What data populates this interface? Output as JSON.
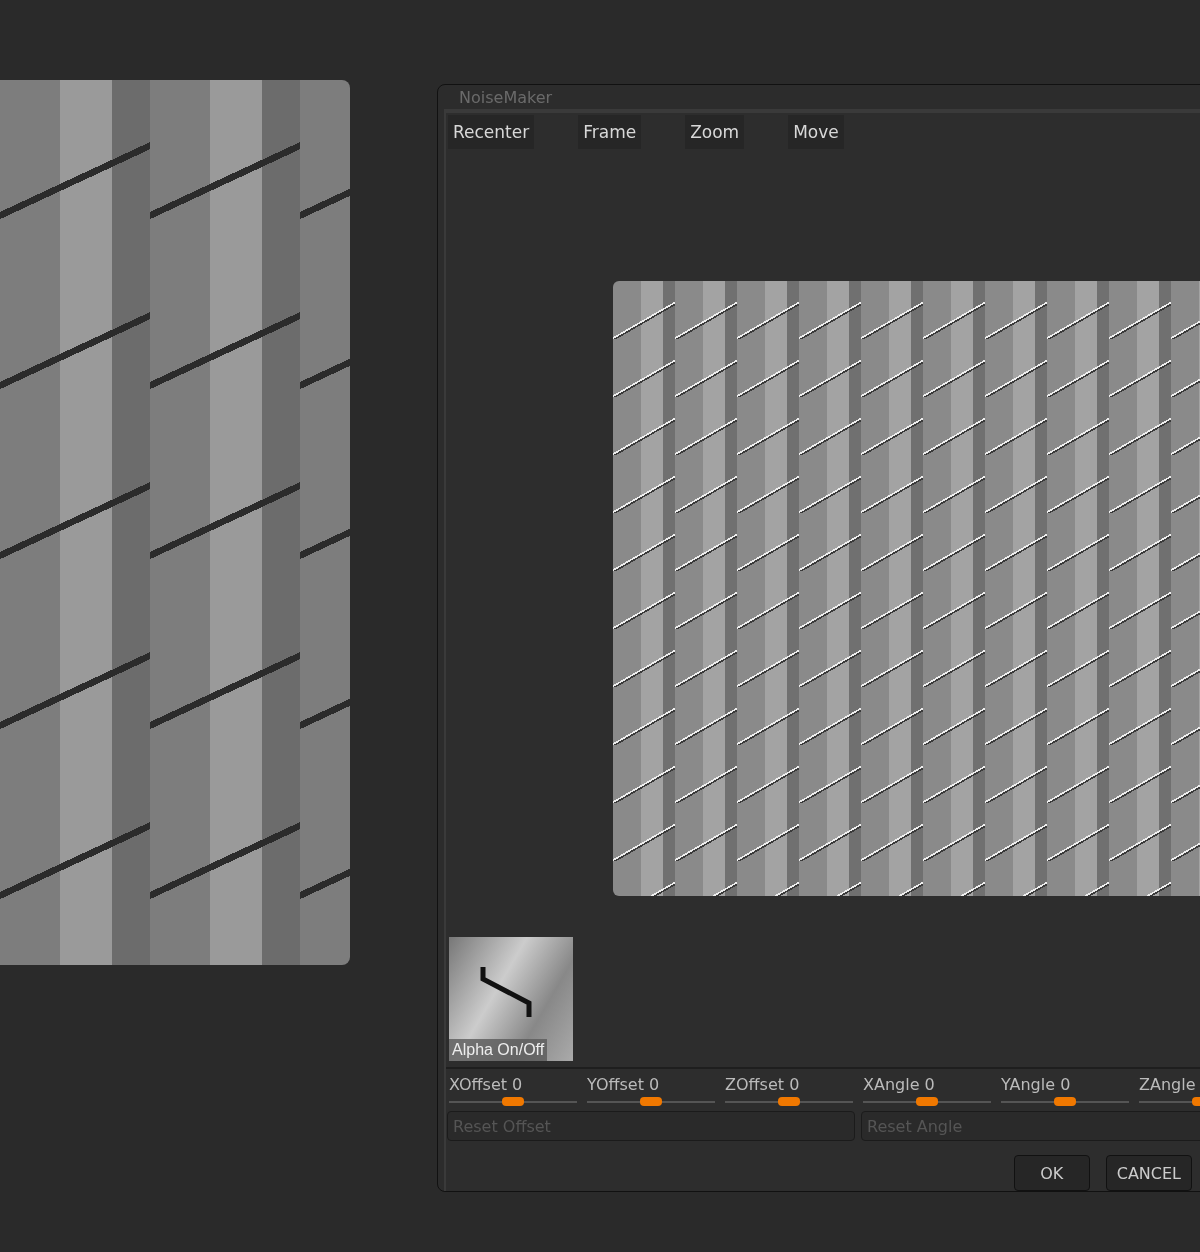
{
  "dialog": {
    "title": "NoiseMaker",
    "toolbar": [
      "Recenter",
      "Frame",
      "Zoom",
      "Move"
    ],
    "alpha": {
      "label": "Alpha On/Off"
    },
    "sliders": [
      {
        "label": "XOffset",
        "value": "0",
        "level": 0.5
      },
      {
        "label": "YOffset",
        "value": "0",
        "level": 0.5
      },
      {
        "label": "ZOffset",
        "value": "0",
        "level": 0.5
      },
      {
        "label": "XAngle",
        "value": "0",
        "level": 0.5
      },
      {
        "label": "YAngle",
        "value": "0",
        "level": 0.5
      },
      {
        "label": "ZAngle",
        "level": 0.5
      }
    ],
    "reset_buttons": [
      {
        "label": "Reset Offset",
        "disabled": true
      },
      {
        "label": "Reset Angle",
        "disabled": true
      }
    ],
    "buttons": [
      "OK",
      "CANCEL"
    ]
  }
}
